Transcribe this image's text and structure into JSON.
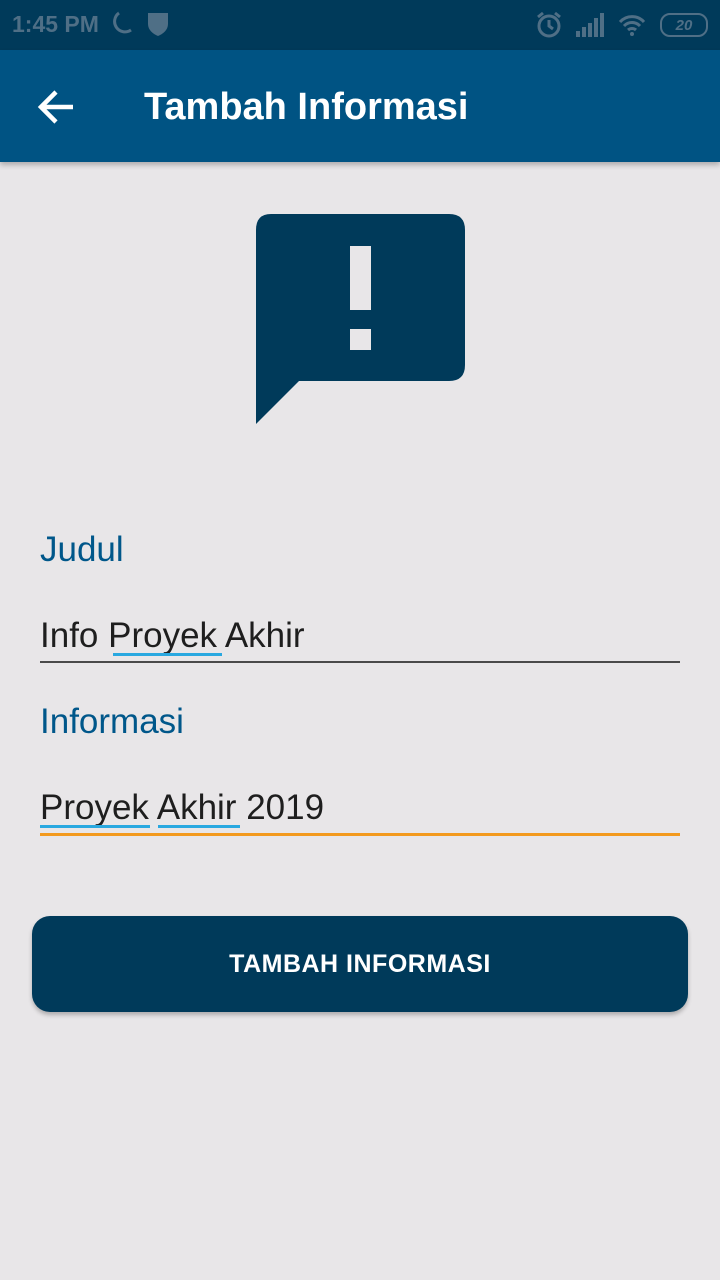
{
  "status_bar": {
    "time": "1:45 PM",
    "battery_level": "20",
    "icons": [
      "moon-icon",
      "shield-icon",
      "alarm-icon",
      "signal-icon",
      "wifi-icon",
      "battery-icon"
    ]
  },
  "app_bar": {
    "title": "Tambah Informasi",
    "back_icon": "arrow-back-icon"
  },
  "illustration": {
    "icon": "feedback-alert-icon"
  },
  "form": {
    "judul": {
      "label": "Judul",
      "value": "Info Proyek Akhir"
    },
    "informasi": {
      "label": "Informasi",
      "value": "Proyek Akhir 2019"
    }
  },
  "submit": {
    "label": "TAMBAH INFORMASI"
  },
  "colors": {
    "status_bar": "#003a5a",
    "app_bar": "#005383",
    "accent": "#00578a",
    "focus_underline": "#f39a1e",
    "button": "#003a5a",
    "background": "#e8e6e8"
  }
}
